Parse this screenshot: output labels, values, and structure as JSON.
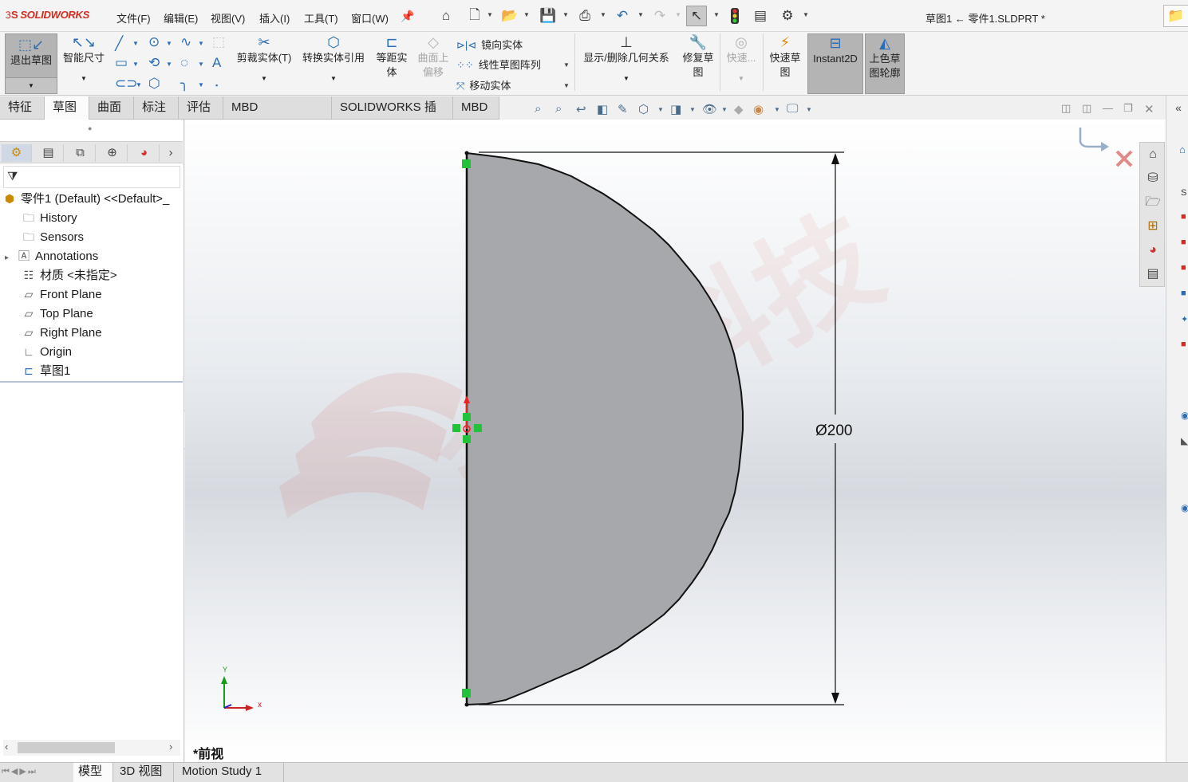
{
  "app": {
    "brand": "SOLIDWORKS",
    "document_title": "草图1 ← 零件1.SLDPRT *"
  },
  "menus": [
    "文件(F)",
    "编辑(E)",
    "视图(V)",
    "插入(I)",
    "工具(T)",
    "窗口(W)"
  ],
  "ribbon": {
    "exit_sketch": "退出草图",
    "smart_dim": "智能尺寸",
    "trim": "剪裁实体(T)",
    "convert": "转换实体引用",
    "offset": "等距实体",
    "surface_offset": "曲面上偏移",
    "mirror": "镜向实体",
    "linear_pattern": "线性草图阵列",
    "move": "移动实体",
    "relations": "显示/删除几何关系",
    "repair": "修复草图",
    "quick_snaps": "快速...",
    "rapid_sketch": "快速草图",
    "instant2d": "Instant2D",
    "shaded_contours": "上色草图轮廓"
  },
  "tabs": [
    "特征",
    "草图",
    "曲面",
    "标注",
    "评估",
    "MBD Dimensions",
    "SOLIDWORKS 插件",
    "MBD"
  ],
  "active_tab": "草图",
  "tree": {
    "root": "零件1 (Default) <<Default>_",
    "items": [
      "History",
      "Sensors",
      "Annotations",
      "材质 <未指定>",
      "Front Plane",
      "Top Plane",
      "Right Plane",
      "Origin",
      "草图1"
    ]
  },
  "viewport": {
    "dimension": "Ø200",
    "view_name": "*前视",
    "triad_x": "x",
    "triad_y": "Y",
    "watermark": "金信科技"
  },
  "bottom_tabs": [
    "模型",
    "3D 视图",
    "Motion Study 1"
  ],
  "active_bottom_tab": "模型",
  "colors": {
    "accent": "#2a6db5",
    "brand": "#d52b1e",
    "sketch_fill": "#a7a8ab",
    "endpoint": "#22c23a"
  }
}
